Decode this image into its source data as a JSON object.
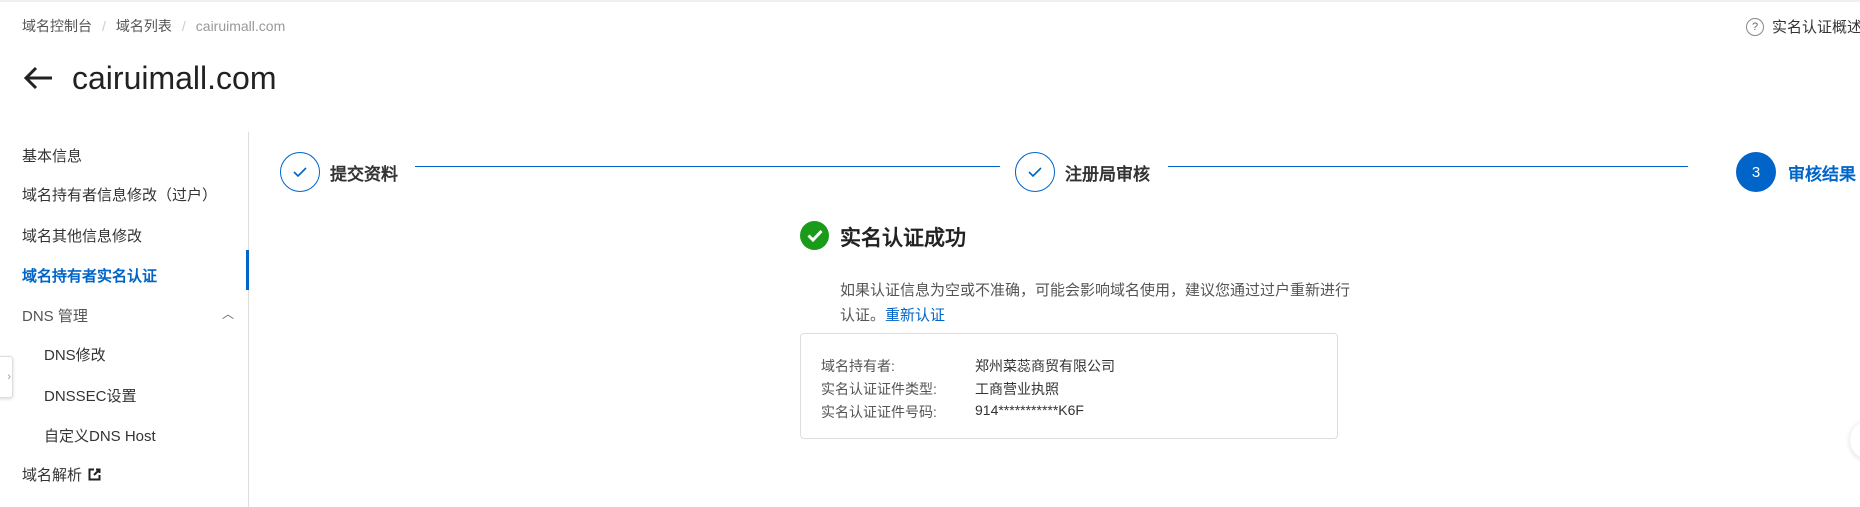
{
  "breadcrumb": [
    "域名控制台",
    "域名列表",
    "cairuimall.com"
  ],
  "help_link": "实名认证概述",
  "page_title": "cairuimall.com",
  "sidebar": {
    "items": [
      {
        "label": "基本信息"
      },
      {
        "label": "域名持有者信息修改（过户）"
      },
      {
        "label": "域名其他信息修改"
      },
      {
        "label": "域名持有者实名认证",
        "active": true
      },
      {
        "label": "DNS 管理"
      },
      {
        "label": "DNS修改"
      },
      {
        "label": "DNSSEC设置"
      },
      {
        "label": "自定义DNS Host"
      },
      {
        "label": "域名解析"
      }
    ]
  },
  "steps": [
    {
      "label": "提交资料",
      "status": "done"
    },
    {
      "label": "注册局审核",
      "status": "done"
    },
    {
      "label": "审核结果",
      "status": "current",
      "number": "3"
    }
  ],
  "result": {
    "title": "实名认证成功",
    "description": "如果认证信息为空或不准确，可能会影响域名使用，建议您通过过户重新进行认证。",
    "reauth_link": "重新认证"
  },
  "info": [
    {
      "label": "域名持有者:",
      "value": "郑州菜蕊商贸有限公司"
    },
    {
      "label": "实名认证证件类型:",
      "value": "工商营业执照"
    },
    {
      "label": "实名认证证件号码:",
      "value": "914***********K6F"
    }
  ],
  "colors": {
    "accent": "#0064c8",
    "success": "#1a9b1a"
  }
}
